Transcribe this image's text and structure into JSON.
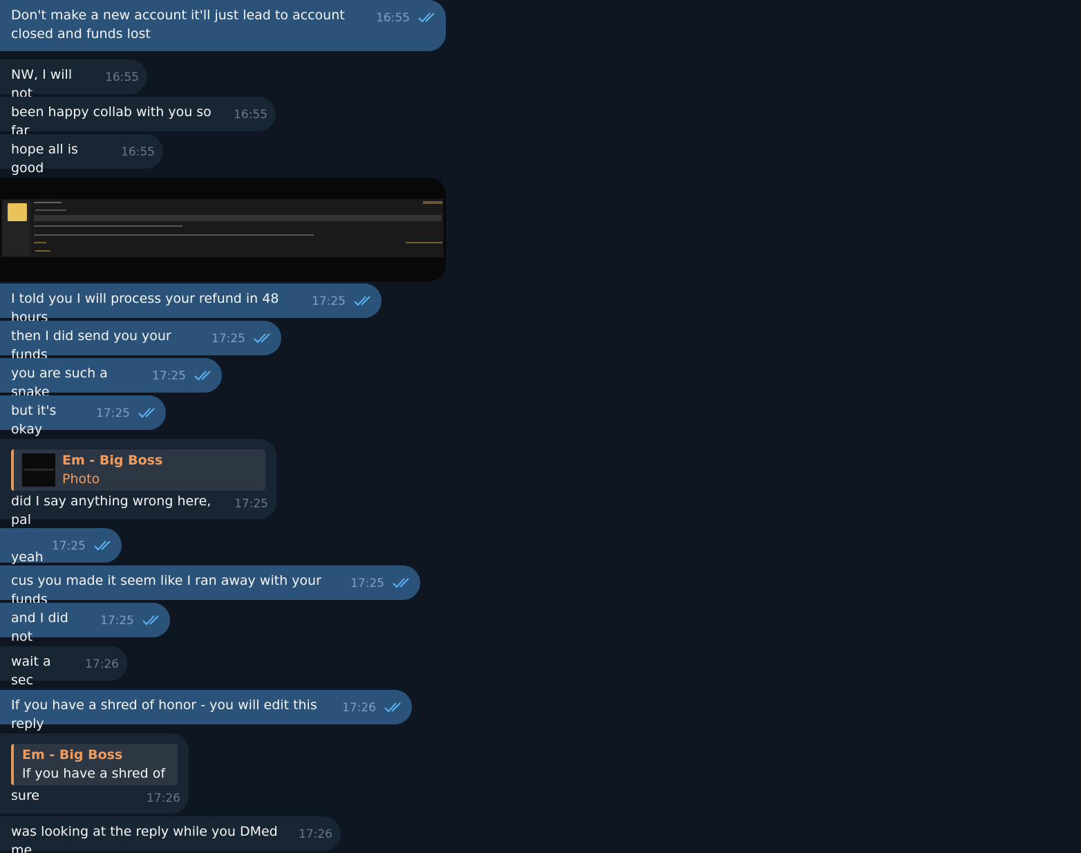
{
  "colors": {
    "background": "#0e1621",
    "outgoing_bubble": "#2b5278",
    "incoming_bubble": "#182533",
    "reply_accent": "#e5995b",
    "read_ticks": "#5eb5f7"
  },
  "messages": [
    {
      "direction": "out",
      "text": "Don't make a new account it'll just lead to account closed and funds lost",
      "time": "16:55",
      "read": true
    },
    {
      "direction": "in",
      "text": "NW, I will not",
      "time": "16:55"
    },
    {
      "direction": "in",
      "text": "been happy collab with you so far",
      "time": "16:55"
    },
    {
      "direction": "in",
      "text": "hope all is good",
      "time": "16:55"
    },
    {
      "direction": "in",
      "type": "photo"
    },
    {
      "direction": "out",
      "text": "I told you I will process your refund in 48 hours",
      "time": "17:25",
      "read": true
    },
    {
      "direction": "out",
      "text": "then I did send you your funds",
      "time": "17:25",
      "read": true
    },
    {
      "direction": "out",
      "text": "you are such a snake",
      "time": "17:25",
      "read": true
    },
    {
      "direction": "out",
      "text": "but it's okay",
      "time": "17:25",
      "read": true
    },
    {
      "direction": "in",
      "text": "did I say anything wrong here, pal",
      "time": "17:25",
      "reply": {
        "name": "Em - Big Boss",
        "text": "Photo"
      }
    },
    {
      "direction": "out",
      "text": "yeah",
      "time": "17:25",
      "read": true
    },
    {
      "direction": "out",
      "text": "cus you made it seem like I ran away with your funds",
      "time": "17:25",
      "read": true
    },
    {
      "direction": "out",
      "text": "and I did not",
      "time": "17:25",
      "read": true
    },
    {
      "direction": "in",
      "text": "wait a sec",
      "time": "17:26"
    },
    {
      "direction": "out",
      "text": "If you have a shred of honor - you will edit this reply",
      "time": "17:26",
      "read": true
    },
    {
      "direction": "in",
      "text": "sure",
      "time": "17:26",
      "reply": {
        "name": "Em - Big Boss",
        "text": "If you have a shred of ..."
      }
    },
    {
      "direction": "in",
      "text": "was looking at the reply while you DMed me",
      "time": "17:26"
    }
  ]
}
